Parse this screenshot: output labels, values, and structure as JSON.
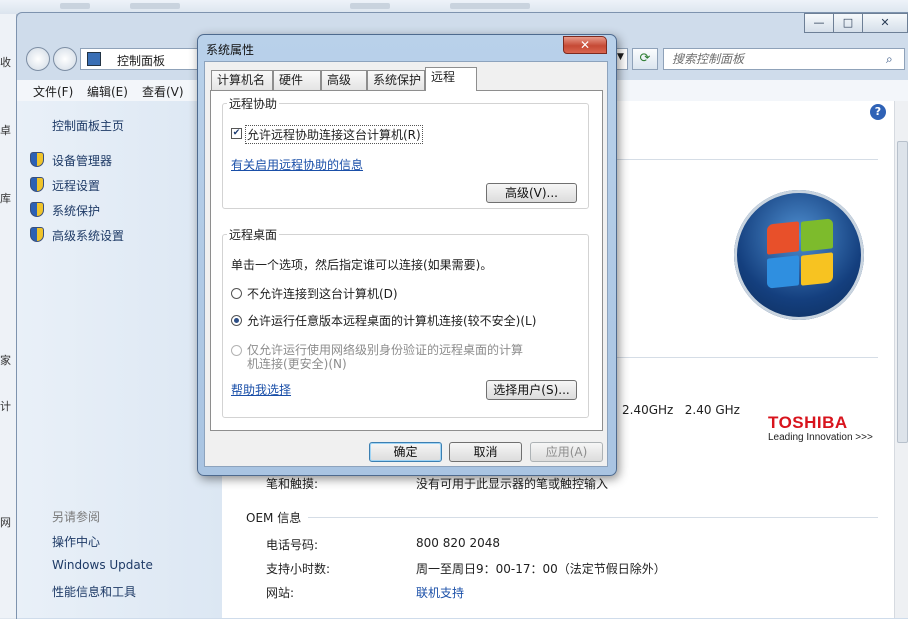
{
  "main_window": {
    "search_placeholder": "搜索控制面板",
    "breadcrumb": "控制面板",
    "caption_buttons": {
      "minimize": "—",
      "maximize": "□",
      "close": "✕"
    },
    "menu": [
      "文件(F)",
      "编辑(E)",
      "查看(V)"
    ],
    "left_pane": {
      "home": "控制面板主页",
      "tasks": [
        "设备管理器",
        "远程设置",
        "系统保护",
        "高级系统设置"
      ],
      "see_also_title": "另请参阅",
      "see_also": [
        "操作中心",
        "Windows Update",
        "性能信息和工具"
      ]
    },
    "left_strip_chars": [
      "收",
      "卓",
      "库",
      "家",
      "计",
      "网"
    ],
    "cpu_speed": "2.40GHz   2.40 GHz",
    "brand": {
      "name": "TOSHIBA",
      "tagline": "Leading Innovation >>>"
    },
    "pen_touch": {
      "label": "笔和触摸:",
      "value": "没有可用于此显示器的笔或触控输入"
    },
    "oem": {
      "title": "OEM 信息",
      "rows": [
        {
          "label": "电话号码:",
          "value": "800 820 2048"
        },
        {
          "label": "支持小时数:",
          "value": "周一至周日9：00-17：00（法定节假日除外）"
        },
        {
          "label": "网站:",
          "value": "联机支持"
        }
      ]
    },
    "help_icon": "?"
  },
  "dialog": {
    "title": "系统属性",
    "close_glyph": "✕",
    "tabs": [
      "计算机名",
      "硬件",
      "高级",
      "系统保护",
      "远程"
    ],
    "active_tab": "远程",
    "remote_assistance": {
      "group_title": "远程协助",
      "allow_checkbox": "允许远程协助连接这台计算机(R)",
      "allow_checked": true,
      "info_link": "有关启用远程协助的信息",
      "advanced_button": "高级(V)..."
    },
    "remote_desktop": {
      "group_title": "远程桌面",
      "instruction": "单击一个选项，然后指定谁可以连接(如果需要)。",
      "options": [
        {
          "label": "不允许连接到这台计算机(D)",
          "selected": false,
          "disabled": false
        },
        {
          "label": "允许运行任意版本远程桌面的计算机连接(较不安全)(L)",
          "selected": true,
          "disabled": false
        },
        {
          "label_line1": "仅允许运行使用网络级别身份验证的远程桌面的计算",
          "label_line2": "机连接(更安全)(N)",
          "selected": false,
          "disabled": true
        }
      ],
      "help_link": "帮助我选择",
      "select_users_button": "选择用户(S)..."
    },
    "buttons": {
      "ok": "确定",
      "cancel": "取消",
      "apply": "应用(A)"
    }
  }
}
